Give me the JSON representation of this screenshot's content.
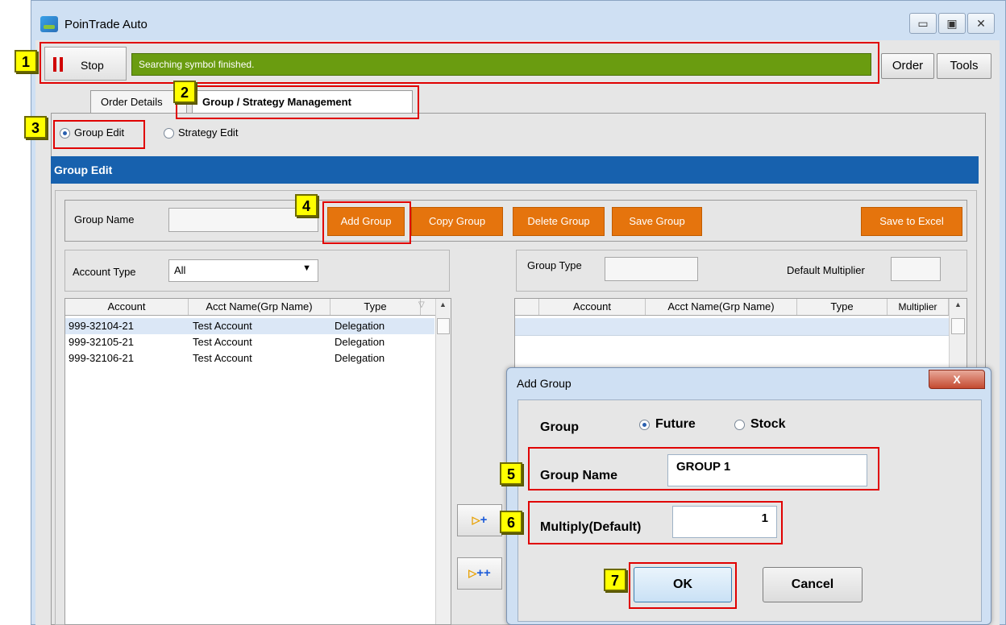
{
  "window": {
    "title": "PoinTrade Auto",
    "controls": {
      "minimize": "▭",
      "maximize": "▣",
      "close": "✕"
    }
  },
  "toolbar": {
    "stop_label": "Stop",
    "status_text": "Searching symbol finished.",
    "order_label": "Order",
    "tools_label": "Tools"
  },
  "tabs": [
    {
      "label": "Order Details"
    },
    {
      "label": "Group / Strategy Management"
    }
  ],
  "mode": {
    "group_edit": "Group Edit",
    "strategy_edit": "Strategy Edit",
    "selected": "Group Edit"
  },
  "group_edit": {
    "header": "Group Edit",
    "group_name_label": "Group Name",
    "group_name_value": "",
    "buttons": {
      "add": "Add Group",
      "copy": "Copy Group",
      "delete": "Delete Group",
      "save": "Save Group",
      "excel": "Save to Excel"
    },
    "account_type_label": "Account Type",
    "account_type_value": "All",
    "group_type_label": "Group Type",
    "default_multiplier_label": "Default Multiplier",
    "left_grid": {
      "columns": [
        "Account",
        "Acct Name(Grp Name)",
        "Type"
      ],
      "rows": [
        [
          "999-32104-21",
          "Test Account",
          "Delegation"
        ],
        [
          "999-32105-21",
          "Test Account",
          "Delegation"
        ],
        [
          "999-32106-21",
          "Test Account",
          "Delegation"
        ]
      ]
    },
    "right_grid": {
      "columns": [
        "Account",
        "Acct Name(Grp Name)",
        "Type",
        "Multiplier"
      ]
    },
    "move_buttons": {
      "move_one": "+",
      "move_all": "++"
    }
  },
  "dialog": {
    "title": "Add Group",
    "close": "X",
    "group_label": "Group",
    "future_label": "Future",
    "stock_label": "Stock",
    "selected_group": "Future",
    "group_name_label": "Group Name",
    "group_name_value": "GROUP 1",
    "multiply_label": "Multiply(Default)",
    "multiply_value": "1",
    "ok_label": "OK",
    "cancel_label": "Cancel"
  },
  "annotations": [
    "1",
    "2",
    "3",
    "4",
    "5",
    "6",
    "7"
  ],
  "colors": {
    "status_green": "#6a9c10",
    "header_blue": "#1761ae",
    "action_orange": "#e5740d",
    "highlight_red": "#e00000",
    "marker_yellow": "#ffff00"
  }
}
